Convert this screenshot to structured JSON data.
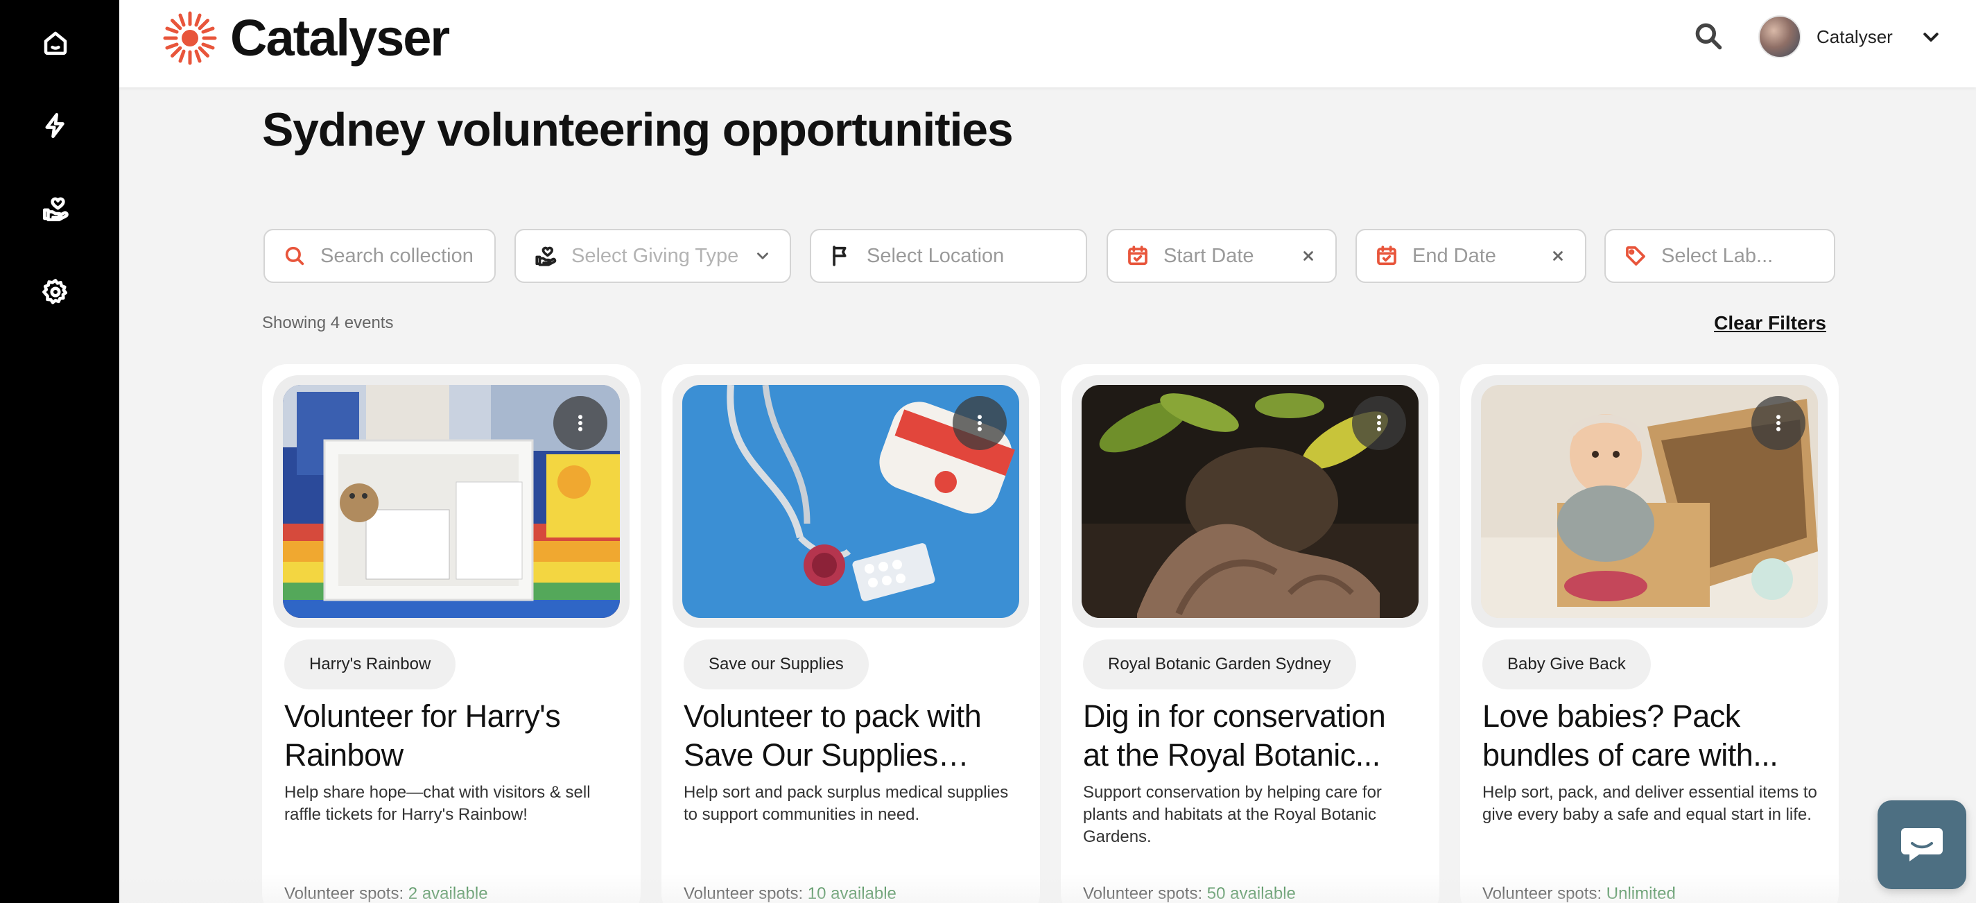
{
  "app": {
    "brand": "Catalyser",
    "accent_color": "#e8553b"
  },
  "nav": {
    "items": [
      {
        "icon": "home-icon"
      },
      {
        "icon": "lightning-icon"
      },
      {
        "icon": "giving-hand-icon"
      },
      {
        "icon": "gear-icon"
      }
    ]
  },
  "header": {
    "search_icon": "search-icon",
    "user_name": "Catalyser",
    "user_menu_icon": "chevron-down-icon"
  },
  "page": {
    "title": "Sydney volunteering opportunities"
  },
  "filters": {
    "search_placeholder": "Search collection",
    "giving_type_placeholder": "Select Giving Type",
    "location_placeholder": "Select Location",
    "start_date_placeholder": "Start Date",
    "end_date_placeholder": "End Date",
    "label_placeholder": "Select Lab...",
    "showing_text": "Showing 4 events",
    "clear_label": "Clear Filters"
  },
  "cards": [
    {
      "org": "Harry's Rainbow",
      "title": "Volunteer for Harry's Rainbow",
      "description": "Help share hope—chat with visitors & sell raffle tickets for Harry's Rainbow!",
      "spots_label": "Volunteer spots:",
      "spots_value": "2 available",
      "image": "gift-box-photo"
    },
    {
      "org": "Save our Supplies",
      "title": "Volunteer to pack with Save Our Supplies and...",
      "description": "Help sort and pack surplus medical supplies to support communities in need.",
      "spots_label": "Volunteer spots:",
      "spots_value": "10 available",
      "image": "medical-supplies-photo"
    },
    {
      "org": "Royal Botanic Garden Sydney",
      "title": "Dig in for conservation at the Royal Botanic...",
      "description": "Support conservation by helping care for plants and habitats at the Royal Botanic Gardens.",
      "spots_label": "Volunteer spots:",
      "spots_value": "50 available",
      "image": "gardening-photo"
    },
    {
      "org": "Baby Give Back",
      "title": "Love babies? Pack bundles of care with...",
      "description": "Help sort, pack, and deliver essential items to give every baby a safe and equal start in life.",
      "spots_label": "Volunteer spots:",
      "spots_value": "Unlimited",
      "image": "baby-in-box-photo"
    }
  ],
  "chat": {
    "icon": "chat-bubble-icon",
    "color": "#4d6f82"
  }
}
